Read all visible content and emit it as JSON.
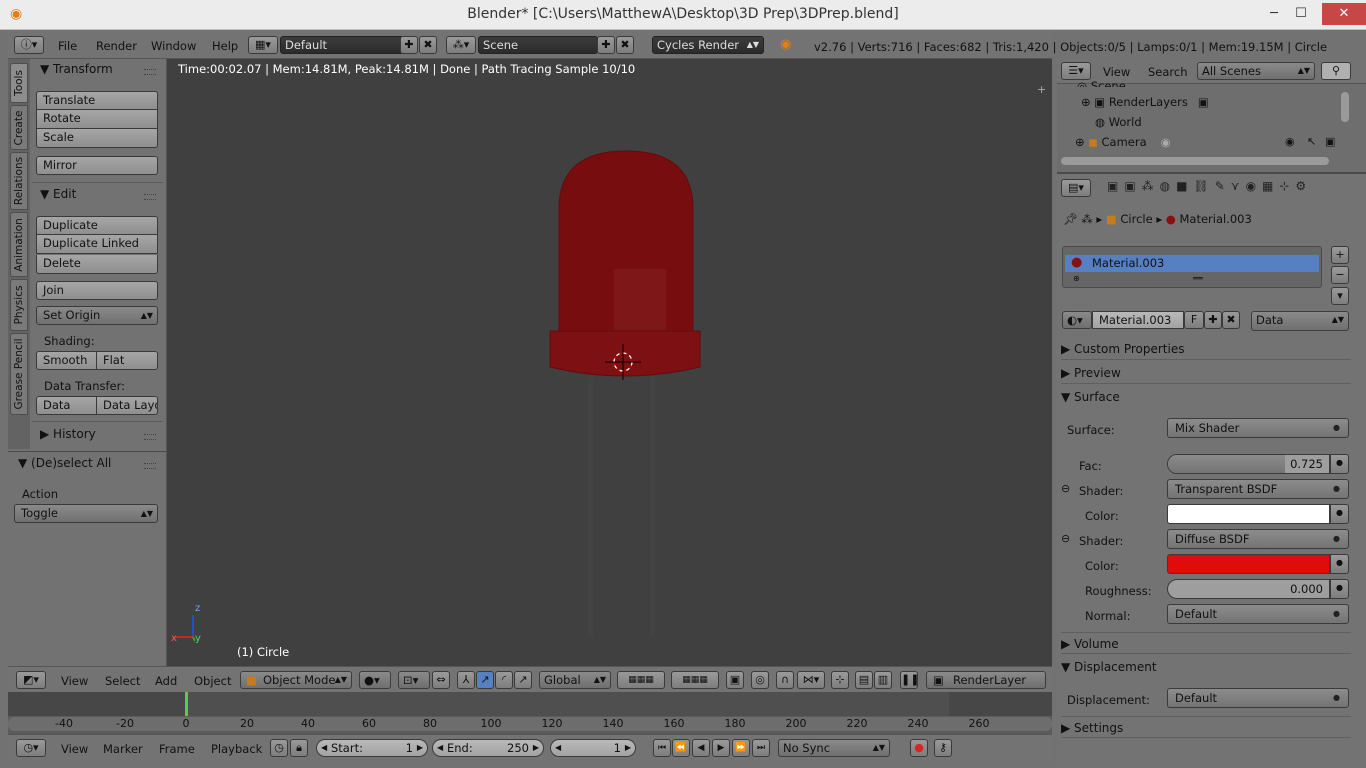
{
  "window": {
    "title": "Blender* [C:\\Users\\MatthewA\\Desktop\\3D Prep\\3DPrep.blend]",
    "minimize": "─",
    "maximize": "☐",
    "close": "✕"
  },
  "info_header": {
    "menus": [
      "File",
      "Render",
      "Window",
      "Help"
    ],
    "layout": "Default",
    "scene": "Scene",
    "engine": "Cycles Render",
    "stats": "v2.76 | Verts:716 | Faces:682 | Tris:1,420 | Objects:0/5 | Lamps:0/1 | Mem:19.15M | Circle"
  },
  "tool_tabs": [
    "Tools",
    "Create",
    "Relations",
    "Animation",
    "Physics",
    "Grease Pencil"
  ],
  "toolshelf": {
    "transform_header": "Transform",
    "translate": "Translate",
    "rotate": "Rotate",
    "scale": "Scale",
    "mirror": "Mirror",
    "edit_header": "Edit",
    "duplicate": "Duplicate",
    "duplicate_linked": "Duplicate Linked",
    "delete": "Delete",
    "join": "Join",
    "set_origin": "Set Origin",
    "shading_label": "Shading:",
    "smooth": "Smooth",
    "flat": "Flat",
    "data_transfer_label": "Data Transfer:",
    "data": "Data",
    "data_layout": "Data Layo",
    "history_header": "History"
  },
  "operator_panel": {
    "header": "(De)select All",
    "action_label": "Action",
    "action_value": "Toggle"
  },
  "viewport": {
    "render_info": "Time:00:02.07 | Mem:14.81M, Peak:14.81M | Done | Path Tracing Sample 10/10",
    "object_name": "(1) Circle",
    "axis_x": "x",
    "axis_y": "y",
    "axis_z": "z"
  },
  "view3d_header": {
    "menus": [
      "View",
      "Select",
      "Add",
      "Object"
    ],
    "mode": "Object Mode",
    "orientation": "Global",
    "render_layer": "RenderLayer"
  },
  "timeline": {
    "ticks": [
      "-40",
      "-20",
      "0",
      "20",
      "40",
      "60",
      "80",
      "100",
      "120",
      "140",
      "160",
      "180",
      "200",
      "220",
      "240",
      "260"
    ],
    "current_frame_marker": 0,
    "frame_start": 1,
    "frame_end": 250
  },
  "timeline_header": {
    "menus": [
      "View",
      "Marker",
      "Frame",
      "Playback"
    ],
    "start_label": "Start:",
    "start_value": "1",
    "end_label": "End:",
    "end_value": "250",
    "current_frame": "1",
    "sync": "No Sync"
  },
  "outliner": {
    "menus": [
      "View",
      "Search"
    ],
    "filter": "All Scenes",
    "items": [
      "Scene",
      "RenderLayers",
      "World",
      "Camera"
    ]
  },
  "properties": {
    "breadcrumb_object": "Circle",
    "breadcrumb_material": "Material.003",
    "material_slot": "Material.003",
    "material_name": "Material.003",
    "fake_user": "F",
    "link": "Data",
    "sections": {
      "custom_properties": "Custom Properties",
      "preview": "Preview",
      "surface": "Surface",
      "volume": "Volume",
      "displacement": "Displacement",
      "settings": "Settings"
    },
    "surface": {
      "surface_label": "Surface:",
      "surface_value": "Mix Shader",
      "fac_label": "Fac:",
      "fac_value": "0.725",
      "fac_fraction": 0.725,
      "shader1_label": "Shader:",
      "shader1_value": "Transparent BSDF",
      "color1_label": "Color:",
      "color1": "#ffffff",
      "shader2_label": "Shader:",
      "shader2_value": "Diffuse BSDF",
      "color2_label": "Color:",
      "color2": "#e00c0c",
      "roughness_label": "Roughness:",
      "roughness_value": "0.000",
      "normal_label": "Normal:",
      "normal_value": "Default"
    },
    "displacement": {
      "label": "Displacement:",
      "value": "Default"
    }
  },
  "colors": {
    "led": "#7a0e10",
    "selected_row": "#5680c2",
    "frame_marker": "#4ed04e"
  }
}
